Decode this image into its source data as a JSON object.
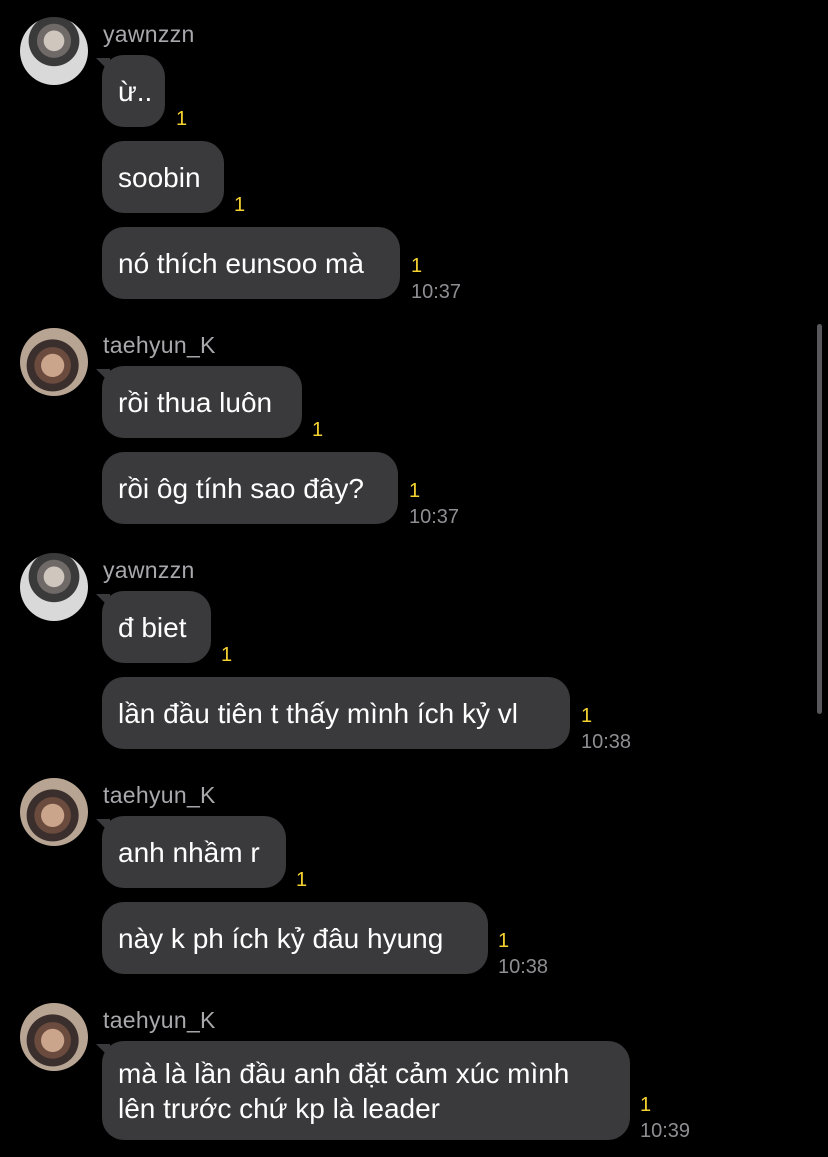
{
  "senders": {
    "yawnzzn": "yawnzzn",
    "taehyun": "taehyun_K"
  },
  "messages": [
    {
      "text": "ừ..",
      "unread": "1"
    },
    {
      "text": "soobin",
      "unread": "1"
    },
    {
      "text": "nó thích eunsoo mà",
      "unread": "1",
      "time": "10:37"
    },
    {
      "text": "rồi thua luôn",
      "unread": "1"
    },
    {
      "text": "rồi ôg tính sao đây?",
      "unread": "1",
      "time": "10:37"
    },
    {
      "text": "đ biet",
      "unread": "1"
    },
    {
      "text": "lần đầu tiên t thấy mình ích kỷ vl",
      "unread": "1",
      "time": "10:38"
    },
    {
      "text": "anh nhầm r",
      "unread": "1"
    },
    {
      "text": "này k ph ích kỷ đâu hyung",
      "unread": "1",
      "time": "10:38"
    },
    {
      "text": "mà là lần đầu anh đặt cảm xúc mình lên trước chứ kp là leader",
      "unread": "1",
      "time": "10:39"
    }
  ]
}
